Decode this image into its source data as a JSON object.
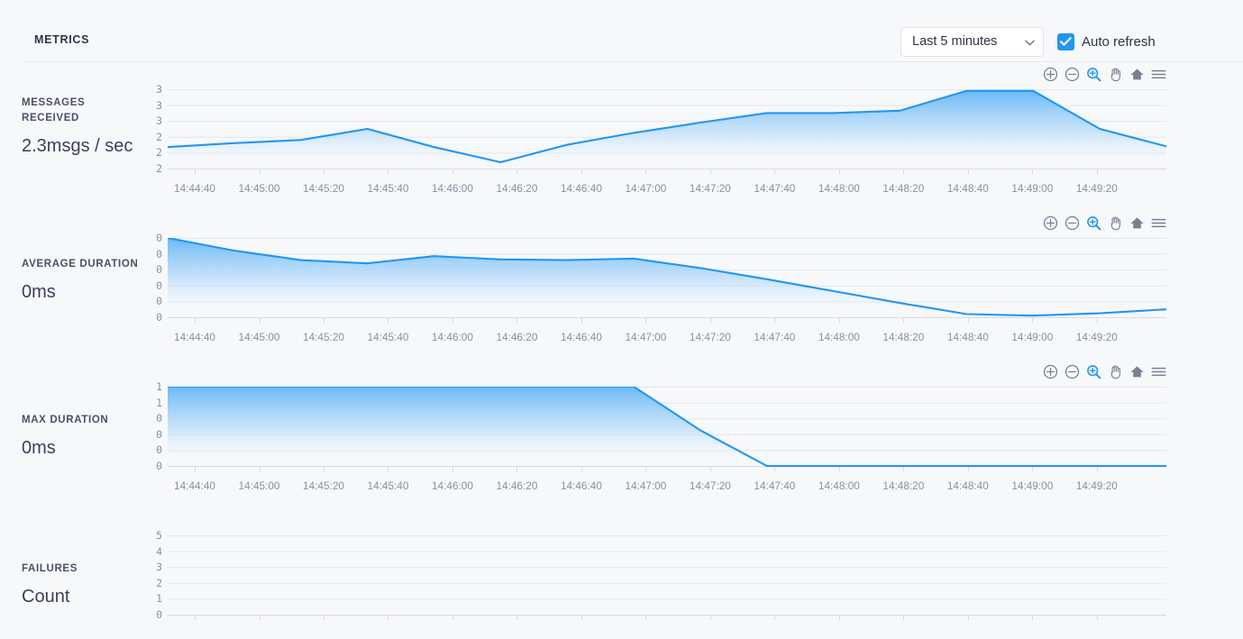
{
  "header": {
    "title": "METRICS",
    "range_selector": {
      "value": "Last 5 minutes",
      "icon": "chevron-down-icon"
    },
    "auto_refresh": {
      "label": "Auto refresh",
      "checked": true,
      "accent": "#2196f3"
    }
  },
  "toolbar": {
    "icons": [
      {
        "name": "zoom-in-icon",
        "title": "Zoom in",
        "active": false
      },
      {
        "name": "zoom-out-icon",
        "title": "Zoom out",
        "active": false
      },
      {
        "name": "zoom-selection-icon",
        "title": "Zoom selection",
        "active": true
      },
      {
        "name": "pan-icon",
        "title": "Pan",
        "active": false
      },
      {
        "name": "home-icon",
        "title": "Reset zoom",
        "active": false
      },
      {
        "name": "menu-icon",
        "title": "Menu",
        "active": false
      }
    ]
  },
  "colors": {
    "accent": "#2196f3",
    "area_top": "#64b5f6",
    "background": "#f7f8fa",
    "gridline": "#e4e6eb",
    "tick_text": "#8b8f9e",
    "label_text": "#4a5066"
  },
  "x_axis_labels": [
    "14:44:40",
    "14:45:00",
    "14:45:20",
    "14:45:40",
    "14:46:00",
    "14:46:20",
    "14:46:40",
    "14:47:00",
    "14:47:20",
    "14:47:40",
    "14:48:00",
    "14:48:20",
    "14:48:40",
    "14:49:00",
    "14:49:20"
  ],
  "metrics": [
    {
      "id": "messages-received",
      "title": "MESSAGES RECEIVED",
      "value": "2.3msgs / sec",
      "y_ticks": [
        "3",
        "3",
        "3",
        "2",
        "2",
        "2"
      ]
    },
    {
      "id": "average-duration",
      "title": "AVERAGE DURATION",
      "value": "0ms",
      "y_ticks": [
        "0",
        "0",
        "0",
        "0",
        "0",
        "0"
      ]
    },
    {
      "id": "max-duration",
      "title": "MAX DURATION",
      "value": "0ms",
      "y_ticks": [
        "1",
        "1",
        "0",
        "0",
        "0",
        "0"
      ]
    },
    {
      "id": "failures",
      "title": "FAILURES",
      "value": "Count",
      "y_ticks": [
        "5",
        "4",
        "3",
        "2",
        "1",
        "0"
      ]
    }
  ],
  "chart_data": [
    {
      "type": "area",
      "id": "messages-received",
      "title": "MESSAGES RECEIVED",
      "ylabel": "msgs / sec",
      "xlabel": "",
      "grid": true,
      "legend": false,
      "ytick_labels": [
        "3",
        "3",
        "3",
        "2",
        "2",
        "2"
      ],
      "ylim": [
        2.0,
        3.0
      ],
      "x": [
        "14:44:40",
        "14:45:00",
        "14:45:20",
        "14:45:40",
        "14:46:00",
        "14:46:20",
        "14:46:40",
        "14:47:00",
        "14:47:20",
        "14:47:40",
        "14:48:00",
        "14:48:20",
        "14:48:40",
        "14:49:00",
        "14:49:20",
        "14:49:40"
      ],
      "values": [
        2.27,
        2.32,
        2.36,
        2.5,
        2.27,
        2.08,
        2.3,
        2.45,
        2.58,
        2.7,
        2.7,
        2.73,
        2.98,
        2.98,
        2.5,
        2.28
      ]
    },
    {
      "type": "area",
      "id": "average-duration",
      "title": "AVERAGE DURATION",
      "ylabel": "ms",
      "xlabel": "",
      "grid": true,
      "legend": false,
      "ytick_labels": [
        "0",
        "0",
        "0",
        "0",
        "0",
        "0"
      ],
      "ylim": [
        0,
        1
      ],
      "x": [
        "14:44:40",
        "14:45:00",
        "14:45:20",
        "14:45:40",
        "14:46:00",
        "14:46:20",
        "14:46:40",
        "14:47:00",
        "14:47:20",
        "14:47:40",
        "14:48:00",
        "14:48:20",
        "14:48:40",
        "14:49:00",
        "14:49:20",
        "14:49:40"
      ],
      "values": [
        1.0,
        0.84,
        0.72,
        0.68,
        0.77,
        0.73,
        0.72,
        0.74,
        0.62,
        0.48,
        0.33,
        0.18,
        0.04,
        0.02,
        0.05,
        0.1
      ]
    },
    {
      "type": "area",
      "id": "max-duration",
      "title": "MAX DURATION",
      "ylabel": "ms",
      "xlabel": "",
      "grid": true,
      "legend": false,
      "ytick_labels": [
        "1",
        "1",
        "0",
        "0",
        "0",
        "0"
      ],
      "ylim": [
        0,
        1
      ],
      "x": [
        "14:44:40",
        "14:45:00",
        "14:45:20",
        "14:45:40",
        "14:46:00",
        "14:46:20",
        "14:46:40",
        "14:47:00",
        "14:47:20",
        "14:47:40",
        "14:48:00",
        "14:48:20",
        "14:48:40",
        "14:49:00",
        "14:49:20",
        "14:49:40"
      ],
      "values": [
        1.0,
        1.0,
        1.0,
        1.0,
        1.0,
        1.0,
        1.0,
        1.0,
        0.45,
        0.0,
        0.0,
        0.0,
        0.0,
        0.0,
        0.0,
        0.0
      ]
    },
    {
      "type": "area",
      "id": "failures",
      "title": "FAILURES",
      "ylabel": "Count",
      "xlabel": "",
      "grid": true,
      "legend": false,
      "ytick_labels": [
        "5",
        "4",
        "3",
        "2",
        "1",
        "0"
      ],
      "ylim": [
        0,
        5
      ],
      "x": [
        "14:44:40",
        "14:45:00",
        "14:45:20",
        "14:45:40",
        "14:46:00",
        "14:46:20",
        "14:46:40",
        "14:47:00",
        "14:47:20",
        "14:47:40",
        "14:48:00",
        "14:48:20",
        "14:48:40",
        "14:49:00",
        "14:49:20",
        "14:49:40"
      ],
      "values": []
    }
  ]
}
